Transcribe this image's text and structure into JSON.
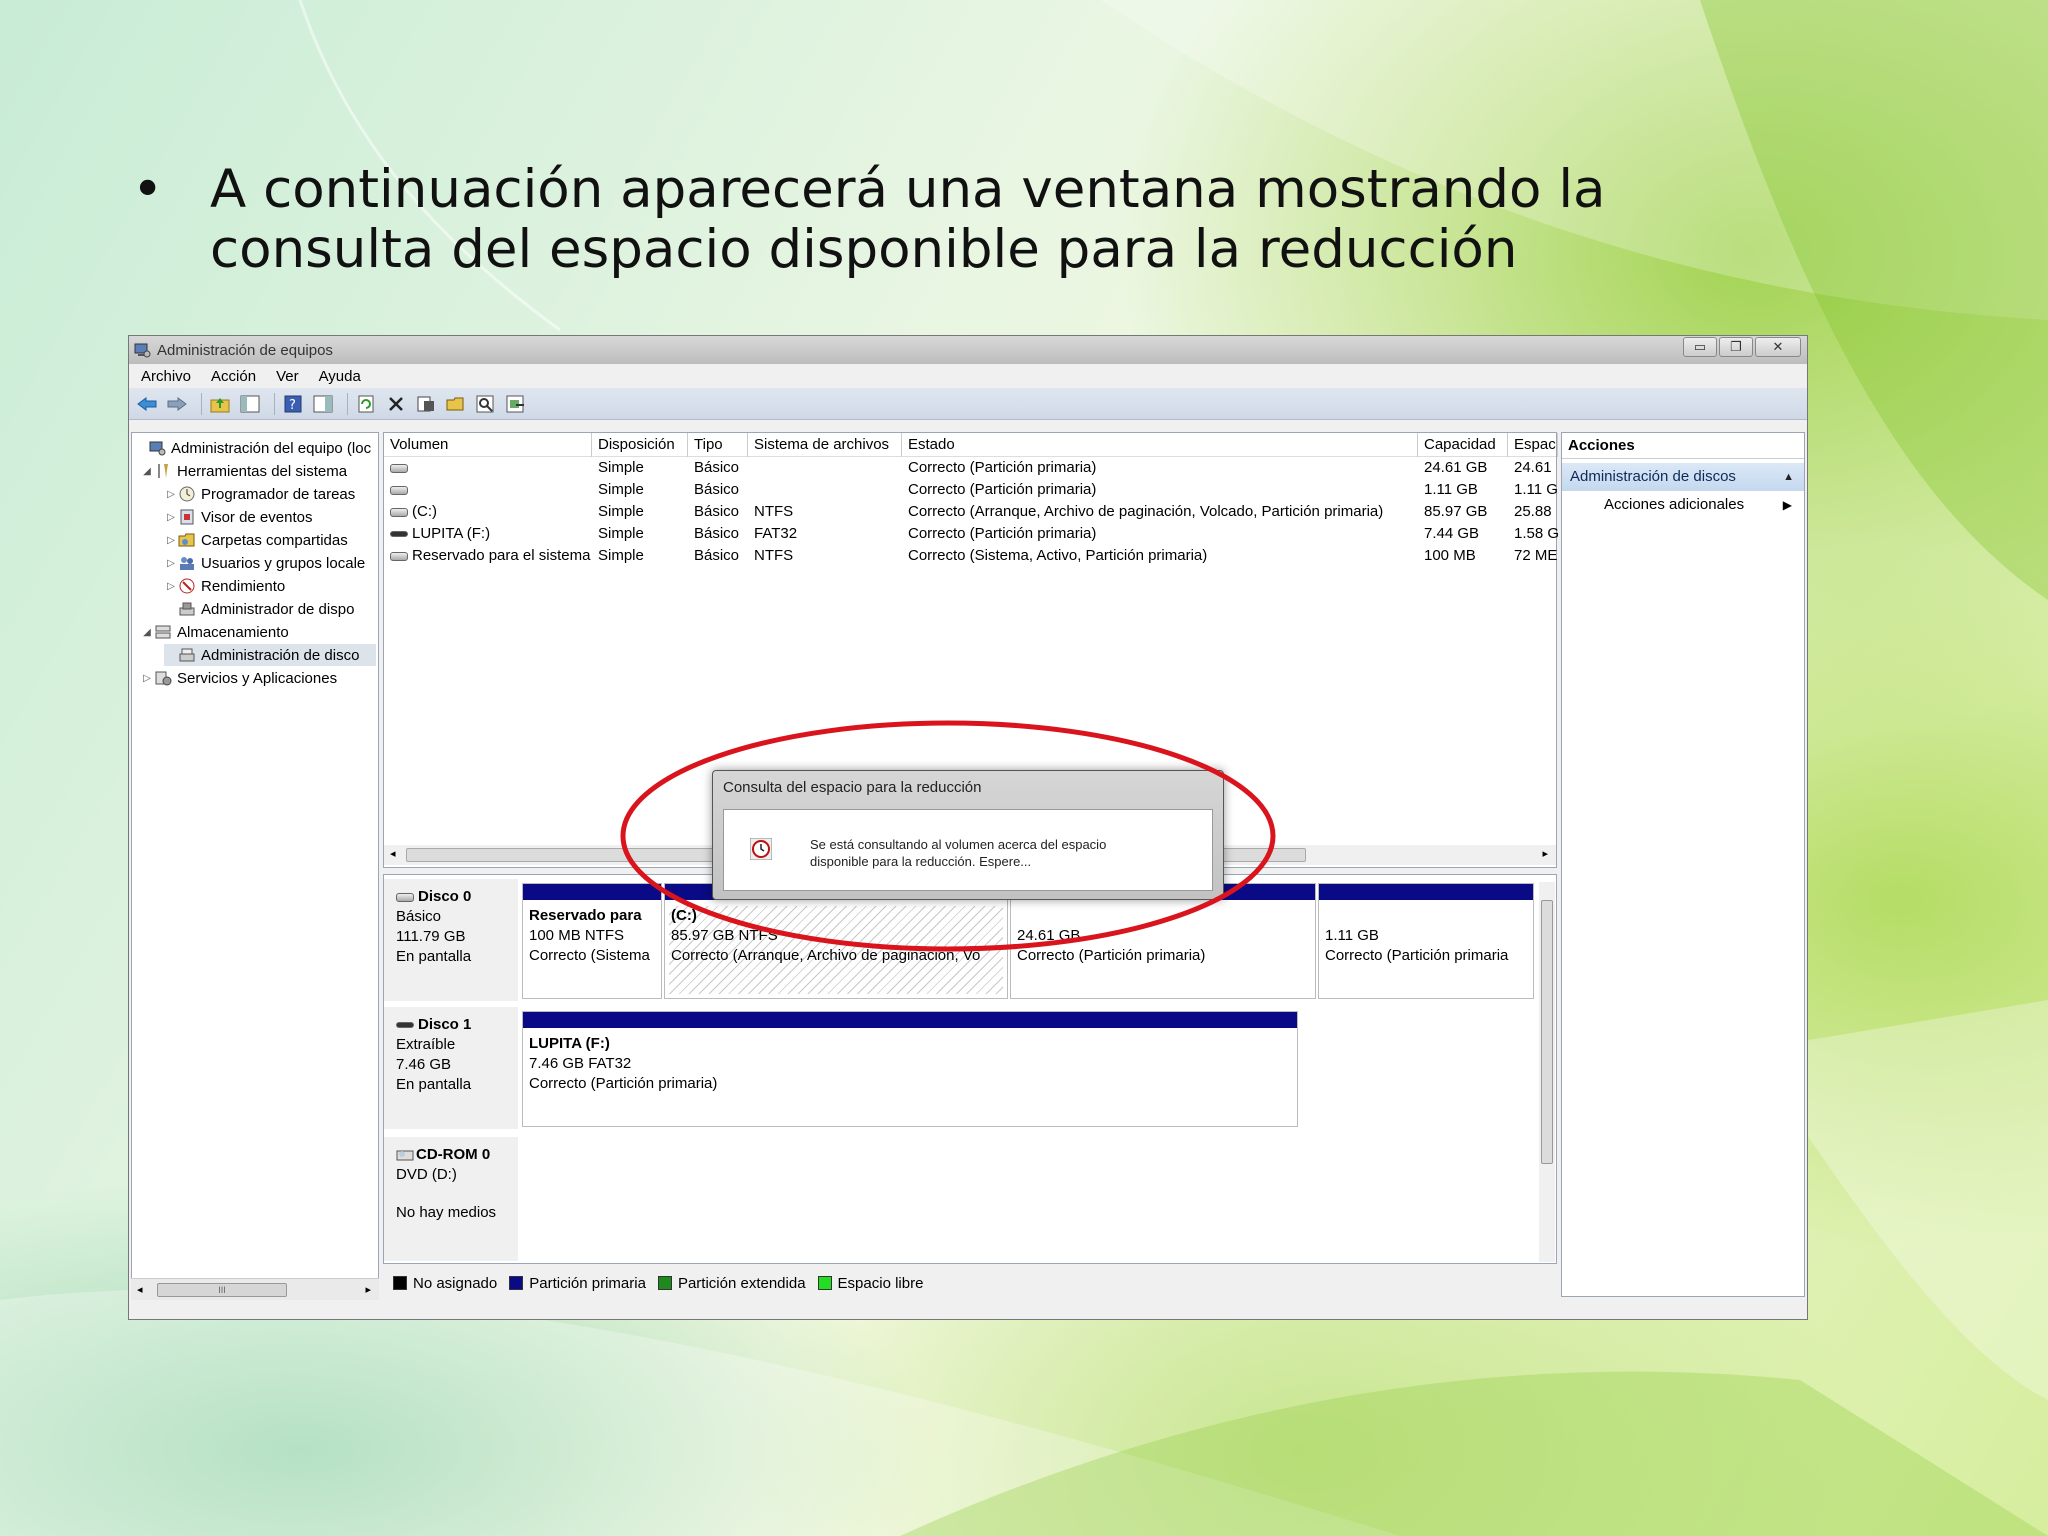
{
  "slide": {
    "bullet": "•",
    "text": "A continuación aparecerá una ventana mostrando la consulta del espacio disponible para la reducción"
  },
  "window": {
    "title": "Administración de equipos",
    "buttons": {
      "minimize": "▭",
      "restore": "❐",
      "close": "✕"
    },
    "menu": [
      "Archivo",
      "Acción",
      "Ver",
      "Ayuda"
    ],
    "toolbar_icons": [
      "back-arrow-icon",
      "forward-arrow-icon",
      "up-folder-icon",
      "show-hide-tree-icon",
      "help-icon",
      "panel-icon",
      "refresh-icon",
      "delete-icon",
      "properties-icon",
      "open-icon",
      "search-icon",
      "more-icon"
    ]
  },
  "tree": {
    "items": [
      {
        "label": "Administración del equipo (loc",
        "arrow": "",
        "level": 0
      },
      {
        "label": "Herramientas del sistema",
        "arrow": "◢",
        "level": 1
      },
      {
        "label": "Programador de tareas",
        "arrow": "▷",
        "level": 2
      },
      {
        "label": "Visor de eventos",
        "arrow": "▷",
        "level": 2
      },
      {
        "label": "Carpetas compartidas",
        "arrow": "▷",
        "level": 2
      },
      {
        "label": "Usuarios y grupos locale",
        "arrow": "▷",
        "level": 2
      },
      {
        "label": "Rendimiento",
        "arrow": "▷",
        "level": 2
      },
      {
        "label": "Administrador de dispo",
        "arrow": "",
        "level": 2
      },
      {
        "label": "Almacenamiento",
        "arrow": "◢",
        "level": 1
      },
      {
        "label": "Administración de disco",
        "arrow": "",
        "level": 2
      },
      {
        "label": "Servicios y Aplicaciones",
        "arrow": "▷",
        "level": 1
      }
    ],
    "scroll_grip": "III",
    "scroll_left": "◂",
    "scroll_right": "▸"
  },
  "volumes": {
    "headers": [
      "Volumen",
      "Disposición",
      "Tipo",
      "Sistema de archivos",
      "Estado",
      "Capacidad",
      "Espac"
    ],
    "rows": [
      {
        "volume": "",
        "layout": "Simple",
        "type": "Básico",
        "fs": "",
        "status": "Correcto (Partición primaria)",
        "capacity": "24.61 GB",
        "free": "24.61"
      },
      {
        "volume": "",
        "layout": "Simple",
        "type": "Básico",
        "fs": "",
        "status": "Correcto (Partición primaria)",
        "capacity": "1.11 GB",
        "free": "1.11 G"
      },
      {
        "volume": "(C:)",
        "layout": "Simple",
        "type": "Básico",
        "fs": "NTFS",
        "status": "Correcto (Arranque, Archivo de paginación, Volcado, Partición primaria)",
        "capacity": "85.97 GB",
        "free": "25.88"
      },
      {
        "volume": "LUPITA (F:)",
        "layout": "Simple",
        "type": "Básico",
        "fs": "FAT32",
        "status": "Correcto (Partición primaria)",
        "capacity": "7.44 GB",
        "free": "1.58 G"
      },
      {
        "volume": "Reservado para el sistema",
        "layout": "Simple",
        "type": "Básico",
        "fs": "NTFS",
        "status": "Correcto (Sistema, Activo, Partición primaria)",
        "capacity": "100 MB",
        "free": "72 ME"
      }
    ],
    "scroll_left": "◂",
    "scroll_right": "▸"
  },
  "disks": [
    {
      "name": "Disco 0",
      "kind": "Básico",
      "size": "111.79 GB",
      "state": "En pantalla",
      "partitions": [
        {
          "title": "Reservado para",
          "line1": "100 MB NTFS",
          "line2": "Correcto (Sistema"
        },
        {
          "title": "(C:)",
          "line1": "85.97 GB NTFS",
          "line2": "Correcto (Arranque, Archivo de paginación, Vo"
        },
        {
          "title": "",
          "line1": "24.61 GB",
          "line2": "Correcto (Partición primaria)"
        },
        {
          "title": "",
          "line1": "1.11 GB",
          "line2": "Correcto (Partición primaria"
        }
      ]
    },
    {
      "name": "Disco 1",
      "kind": "Extraíble",
      "size": "7.46 GB",
      "state": "En pantalla",
      "partitions": [
        {
          "title": "LUPITA  (F:)",
          "line1": "7.46 GB FAT32",
          "line2": "Correcto (Partición primaria)"
        }
      ]
    },
    {
      "name": "CD-ROM 0",
      "kind": "DVD (D:)",
      "size": "",
      "state": "No hay medios",
      "partitions": []
    }
  ],
  "legend": [
    {
      "label": "No asignado",
      "color": "#000000"
    },
    {
      "label": "Partición primaria",
      "color": "#0a0a86"
    },
    {
      "label": "Partición extendida",
      "color": "#1e8a1e"
    },
    {
      "label": "Espacio libre",
      "color": "#22dd22"
    }
  ],
  "actions": {
    "header": "Acciones",
    "selected": "Administración de discos",
    "selected_arrow": "▲",
    "item": "Acciones adicionales",
    "item_arrow": "▶"
  },
  "dialog": {
    "title": "Consulta del espacio para la reducción",
    "line1": "Se está consultando al volumen acerca del espacio",
    "line2": "disponible para la reducción. Espere..."
  },
  "colors": {
    "highlight_ellipse": "#d9141c",
    "partition_bar": "#0a0a86"
  }
}
